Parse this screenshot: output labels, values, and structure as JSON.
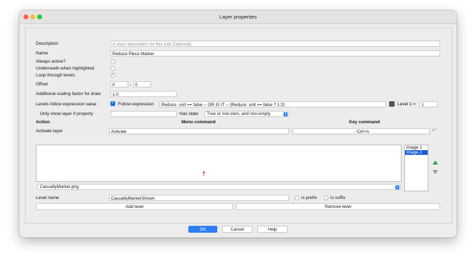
{
  "window": {
    "title": "Layer properties"
  },
  "form": {
    "description_label": "Description",
    "description_placeholder": "A short description for this trait (Optional)",
    "name_label": "Name",
    "name_value": "Reduce Piece Marker",
    "always_active_label": "Always active?",
    "underneath_label": "Underneath when highlighted",
    "loop_label": "Loop through levels",
    "offset_label": "Offset",
    "offset_x": "0",
    "offset_sep": ",",
    "offset_y": "0",
    "scaling_label": "Additional scaling factor for draw",
    "scaling_value": "1.0",
    "levels_follow_label": "Levels follow expression value",
    "follow_expression_label": "Follow expression",
    "expression_value": "Reduce_unit == false      -- OR IS IT --       {Reduce_unit == false ? 1:2}",
    "level1_label": "Level 1 =",
    "level1_value": "1",
    "only_show_label": "Only show layer if property",
    "only_show_value": "",
    "has_state_label": "Has state",
    "has_state_option": "True or non-zero, and non-empty",
    "action_header": "Action",
    "menu_header": "Menu command",
    "key_header": "Key command",
    "activate_label": "Activate layer",
    "activate_menu_value": "Activate",
    "activate_key_value": "- Ctrl+A",
    "image_select_value": "CasualtyMarker.png",
    "image_list": [
      "Image 1",
      "Image 2"
    ],
    "level_name_label": "Level name",
    "level_name_value": "CasualtyMarkerShown",
    "is_prefix_label": "is prefix",
    "is_suffix_label": "is suffix",
    "add_level_label": "Add level",
    "remove_level_label": "Remove level"
  },
  "footer": {
    "ok_label": "OK",
    "cancel_label": "Cancel",
    "help_label": "Help"
  },
  "colors": {
    "accent": "#2f7df6",
    "selection": "#1660d1",
    "marker": "#d21f1f"
  }
}
